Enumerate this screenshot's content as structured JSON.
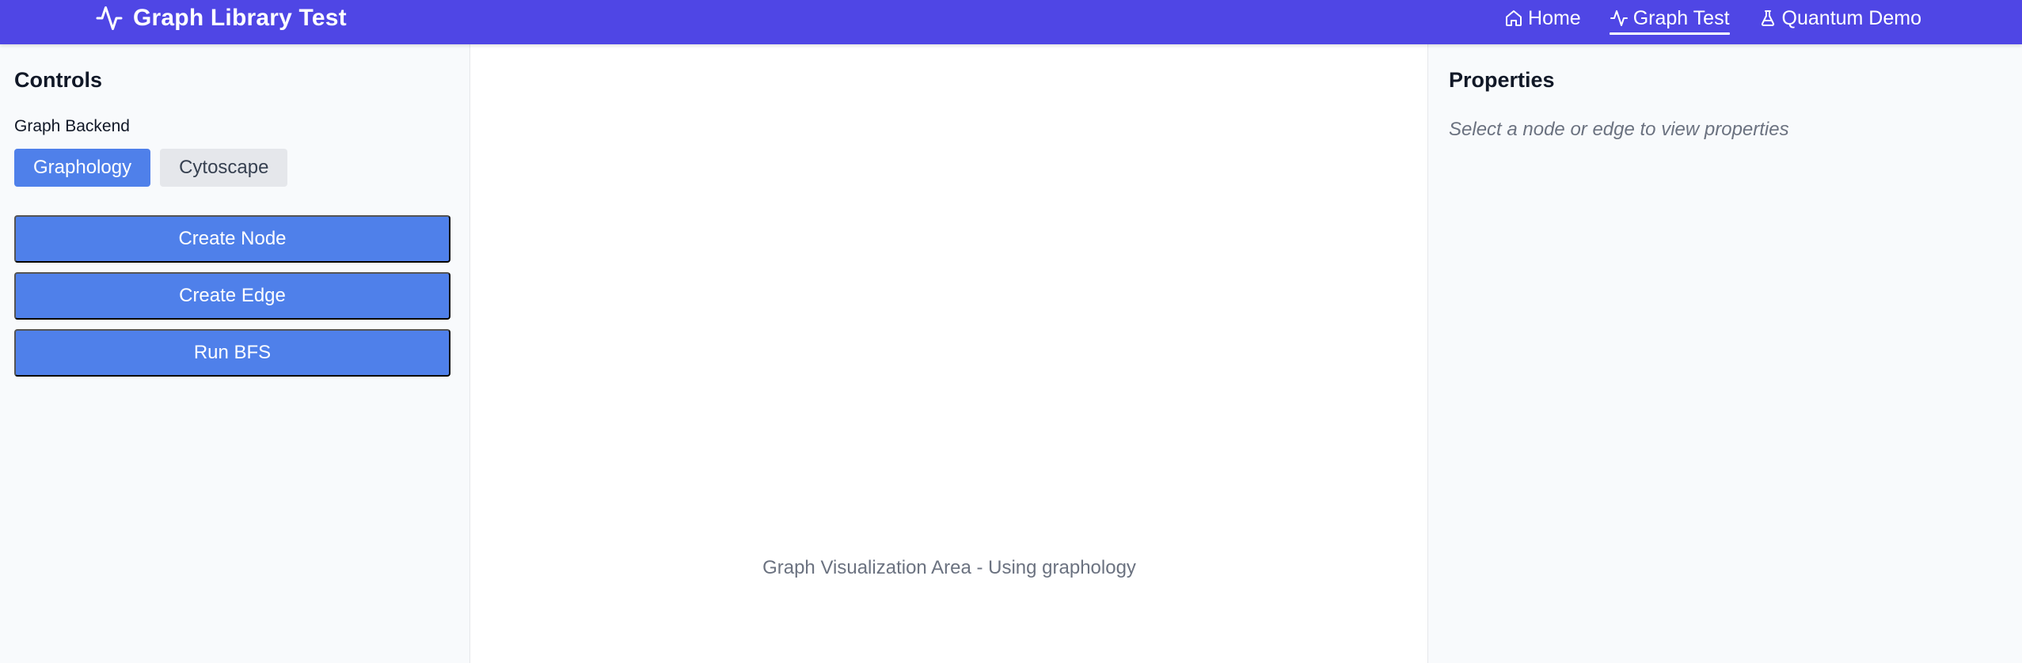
{
  "header": {
    "title": "Graph Library Test",
    "brand_icon": "activity-pulse-icon",
    "nav": [
      {
        "label": "Home",
        "icon": "home-icon",
        "active": false
      },
      {
        "label": "Graph Test",
        "icon": "activity-pulse-icon",
        "active": true
      },
      {
        "label": "Quantum Demo",
        "icon": "flask-icon",
        "active": false
      }
    ],
    "bar_color": "#4f46e5"
  },
  "controls": {
    "title": "Controls",
    "backend_label": "Graph Backend",
    "backends": [
      {
        "label": "Graphology",
        "selected": true
      },
      {
        "label": "Cytoscape",
        "selected": false
      }
    ],
    "actions": [
      {
        "label": "Create Node"
      },
      {
        "label": "Create Edge"
      },
      {
        "label": "Run BFS"
      }
    ],
    "accent_color": "#4f80ea"
  },
  "canvas": {
    "caption": "Graph Visualization Area - Using graphology"
  },
  "properties": {
    "title": "Properties",
    "empty_hint": "Select a node or edge to view properties"
  }
}
